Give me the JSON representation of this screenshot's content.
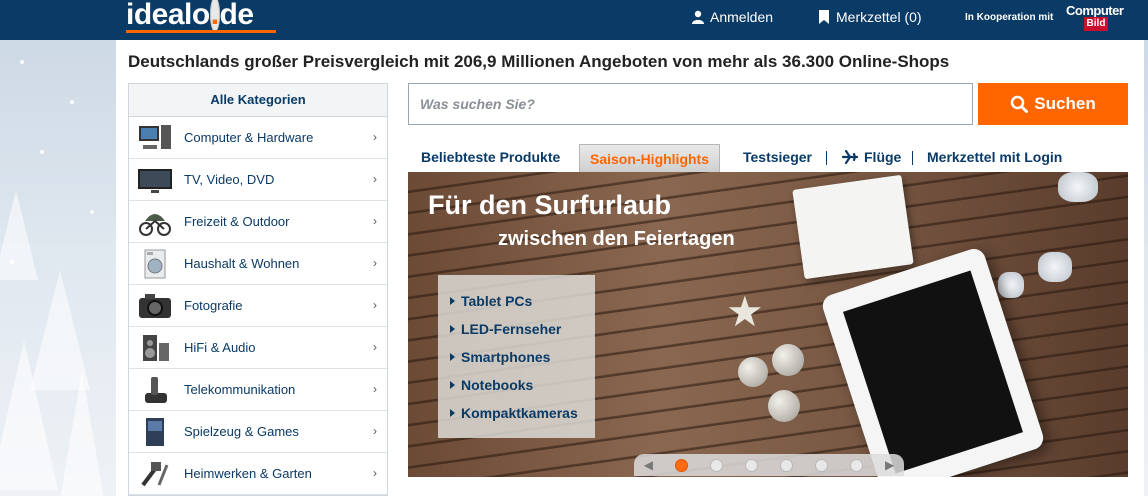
{
  "header": {
    "logo_main": "idealo",
    "logo_dot": ".",
    "logo_tld": "de",
    "login_label": "Anmelden",
    "wishlist_label": "Merkzettel (0)",
    "cooperation_label": "In Kooperation mit",
    "partner_logo_top": "Computer",
    "partner_logo_bottom": "Bild"
  },
  "headline": "Deutschlands großer Preisvergleich mit 206,9 Millionen Angeboten von mehr als 36.300 Online-Shops",
  "sidebar": {
    "title": "Alle Kategorien",
    "items": [
      {
        "label": "Computer & Hardware",
        "icon": "computer-icon"
      },
      {
        "label": "TV, Video, DVD",
        "icon": "tv-icon"
      },
      {
        "label": "Freizeit & Outdoor",
        "icon": "bicycle-icon"
      },
      {
        "label": "Haushalt & Wohnen",
        "icon": "washing-machine-icon"
      },
      {
        "label": "Fotografie",
        "icon": "camera-icon"
      },
      {
        "label": "HiFi & Audio",
        "icon": "speaker-icon"
      },
      {
        "label": "Telekommunikation",
        "icon": "phone-icon"
      },
      {
        "label": "Spielzeug & Games",
        "icon": "game-icon"
      },
      {
        "label": "Heimwerken & Garten",
        "icon": "tools-icon"
      }
    ]
  },
  "search": {
    "placeholder": "Was suchen Sie?",
    "button_label": "Suchen"
  },
  "tabs": [
    {
      "label": "Beliebteste Produkte",
      "active": false
    },
    {
      "label": "Saison-Highlights",
      "active": true
    },
    {
      "label": "Testsieger",
      "active": false
    },
    {
      "label": "Flüge",
      "active": false
    },
    {
      "label": "Merkzettel mit Login",
      "active": false
    }
  ],
  "banner": {
    "title": "Für den Surfurlaub",
    "subtitle": "zwischen den Feiertagen",
    "links": [
      "Tablet PCs",
      "LED-Fernseher",
      "Smartphones",
      "Notebooks",
      "Kompaktkameras"
    ],
    "slides_count": 6,
    "active_slide": 1
  },
  "colors": {
    "brand_blue": "#0a3a66",
    "accent_orange": "#ff6600"
  }
}
